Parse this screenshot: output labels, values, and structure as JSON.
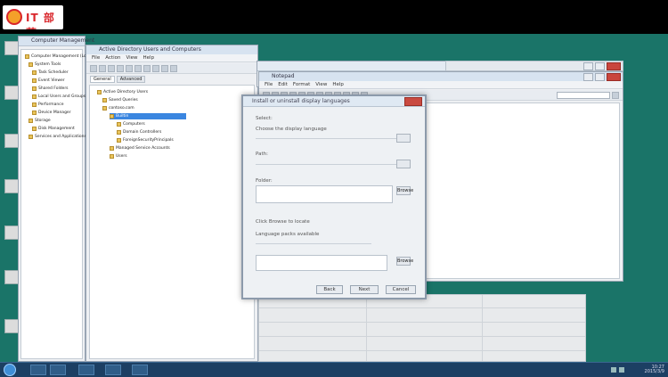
{
  "logo": {
    "text": "IT 部落"
  },
  "explorer": {
    "title": "Computer Management",
    "tree": [
      "Computer Management (Local)",
      "System Tools",
      "Task Scheduler",
      "Event Viewer",
      "Shared Folders",
      "Local Users and Groups",
      "Performance",
      "Device Manager",
      "Storage",
      "Disk Management",
      "Services and Applications"
    ]
  },
  "main_window": {
    "title": "Active Directory Users and Computers",
    "menu": [
      "File",
      "Action",
      "View",
      "Help"
    ],
    "tabs": [
      "General",
      "Advanced"
    ],
    "tree": [
      "Active Directory Users",
      "Saved Queries",
      "contoso.com",
      "Builtin",
      "Computers",
      "Domain Controllers",
      "ForeignSecurityPrincipals",
      "Managed Service Accounts",
      "Users"
    ]
  },
  "editor_window": {
    "title": "Notepad",
    "menu": [
      "File",
      "Edit",
      "Format",
      "View",
      "Help"
    ]
  },
  "dialog": {
    "title": "Install or uninstall display languages",
    "labels": [
      "Select:",
      "Choose the display language",
      "Path:",
      "Folder:",
      "Click Browse to locate",
      "Language packs available"
    ],
    "browse_label": "Browse",
    "buttons": [
      "Back",
      "Next",
      "Cancel"
    ]
  },
  "taskbar": {
    "clock_time": "10:27",
    "clock_date": "2015/3/9"
  }
}
